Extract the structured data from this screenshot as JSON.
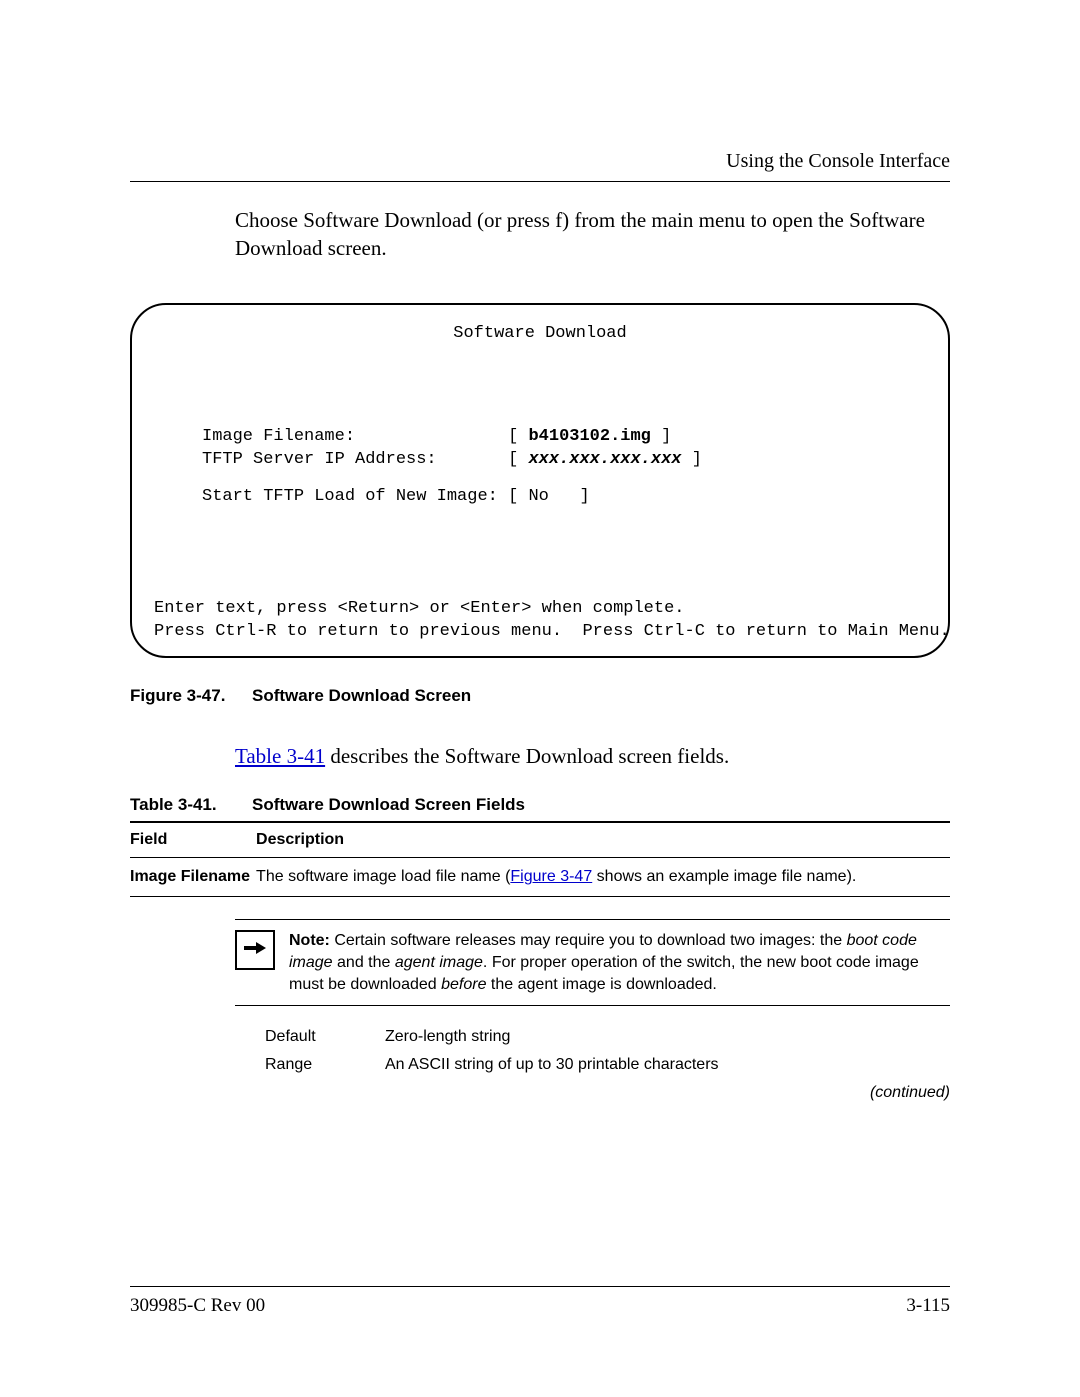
{
  "running_head": "Using the Console Interface",
  "intro": "Choose Software Download (or press f) from the main menu to open the Software Download screen.",
  "terminal": {
    "title": "Software Download",
    "rows": {
      "r1_label": "Image Filename:",
      "r1_value": "b4103102.img",
      "r2_label": "TFTP Server IP Address:",
      "r2_value": "xxx.xxx.xxx.xxx",
      "r3_label": "Start TFTP Load of New Image:",
      "r3_value": "No"
    },
    "footer1": "Enter text, press <Return> or <Enter> when complete.",
    "footer2": "Press Ctrl-R to return to previous menu.  Press Ctrl-C to return to Main Menu."
  },
  "figure": {
    "num": "Figure 3-47.",
    "title": "Software Download Screen"
  },
  "para_link_text": "Table 3-41",
  "para_rest": " describes the Software Download screen fields.",
  "table_caption": {
    "num": "Table 3-41.",
    "title": "Software Download Screen Fields"
  },
  "table": {
    "head_field": "Field",
    "head_desc": "Description",
    "row1_field": "Image Filename",
    "row1_desc_pre": "The software image load file name (",
    "row1_desc_link": "Figure 3-47",
    "row1_desc_post": " shows an example image file name)."
  },
  "note": {
    "label": "Note: ",
    "p1a": "Certain software releases may require you to download two images: the ",
    "p1b": "boot code image",
    "p1c": " and the ",
    "p1d": "agent image",
    "p1e": ". For proper operation of the switch, the new boot code image must be downloaded ",
    "p1f": "before",
    "p1g": " the agent image is downloaded."
  },
  "subtable": {
    "r1k": "Default",
    "r1v": "Zero-length string",
    "r2k": "Range",
    "r2v": "An ASCII string of up to 30 printable characters"
  },
  "continued": "(continued)",
  "footer": {
    "left": "309985-C Rev 00",
    "right": "3-115"
  }
}
